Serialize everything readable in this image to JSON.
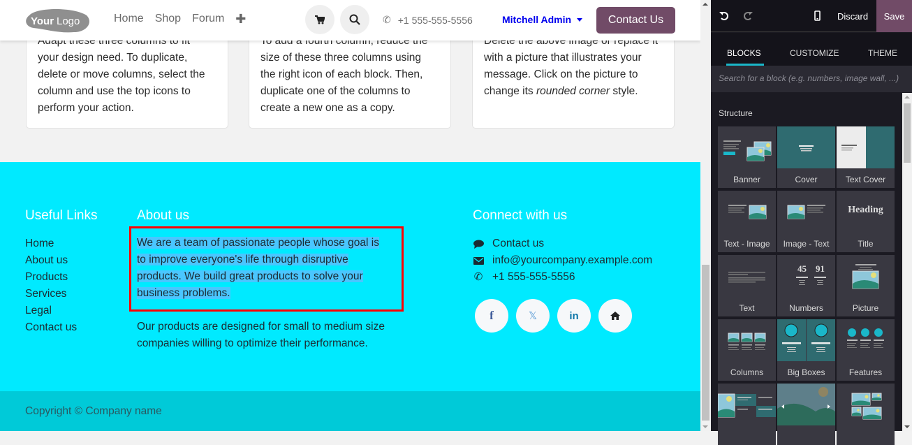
{
  "header": {
    "logo_text_bold": "Your",
    "logo_text_light": "Logo",
    "nav": [
      "Home",
      "Shop",
      "Forum"
    ],
    "add_menu_icon": "plus-icon",
    "cart_icon": "cart-icon",
    "search_icon": "search-icon",
    "phone": "+1 555-555-5556",
    "user_name": "Mitchell Admin",
    "contact_button": "Contact Us"
  },
  "cards": [
    {
      "lines": [
        "Adapt these three columns to fit",
        "your design need. To duplicate,",
        "delete or move columns, select the",
        "column and use the top icons to",
        "perform your action."
      ]
    },
    {
      "lines": [
        "To add a fourth column, reduce the",
        "size of these three columns using",
        "the right icon of each block. Then,",
        "duplicate one of the columns to",
        "create a new one as a copy."
      ]
    },
    {
      "lines": [
        "Delete the above image or replace it",
        "with a picture that illustrates your",
        "message. Click on the picture to"
      ],
      "last_prefix": "change its ",
      "last_italic": "rounded corner",
      "last_suffix": " style."
    }
  ],
  "footer": {
    "useful_links_title": "Useful Links",
    "useful_links": [
      "Home",
      "About us",
      "Products",
      "Services",
      "Legal",
      "Contact us"
    ],
    "about_title": "About us",
    "about_selected_lines": [
      "We are a team of passionate people whose goal is",
      "to improve everyone's life through disruptive",
      "products. We build great products to solve your",
      "business problems."
    ],
    "about_second": "Our products are designed for small to medium size companies willing to optimize their performance.",
    "connect_title": "Connect with us",
    "connect_items": [
      {
        "icon": "comment-icon",
        "text": "Contact us"
      },
      {
        "icon": "envelope-icon",
        "text": "info@yourcompany.example.com"
      },
      {
        "icon": "phone-icon",
        "text": "+1 555-555-5556"
      }
    ],
    "socials": [
      {
        "name": "facebook",
        "glyph": "f",
        "color": "#3b5998"
      },
      {
        "name": "x-twitter",
        "glyph": "𝕏",
        "color": "#5a9bd5"
      },
      {
        "name": "linkedin",
        "glyph": "in",
        "color": "#0e76a8"
      },
      {
        "name": "home",
        "glyph": "⌂",
        "color": "#222222"
      }
    ],
    "copyright": "Copyright © Company name"
  },
  "editor": {
    "undo_icon": "undo-icon",
    "redo_icon": "redo-icon",
    "mobile_icon": "mobile-preview-icon",
    "discard": "Discard",
    "save": "Save",
    "tabs": [
      "BLOCKS",
      "CUSTOMIZE",
      "THEME"
    ],
    "active_tab": "BLOCKS",
    "search_placeholder": "Search for a block (e.g. numbers, image wall, ...)",
    "section_title": "Structure",
    "blocks": [
      "Banner",
      "Cover",
      "Text Cover",
      "Text - Image",
      "Image - Text",
      "Title",
      "Text",
      "Numbers",
      "Picture",
      "Columns",
      "Big Boxes",
      "Features",
      "",
      "",
      ""
    ],
    "title_thumb_text": "Heading",
    "numbers_thumb": [
      "45",
      "91"
    ]
  },
  "colors": {
    "brand": "#714b67",
    "footer_bg": "#00eaff",
    "copyright_bg": "#00cad8",
    "selection": "#4ac6ff",
    "highlight_border": "#ff0000",
    "tab_accent": "#1ab7c9"
  }
}
